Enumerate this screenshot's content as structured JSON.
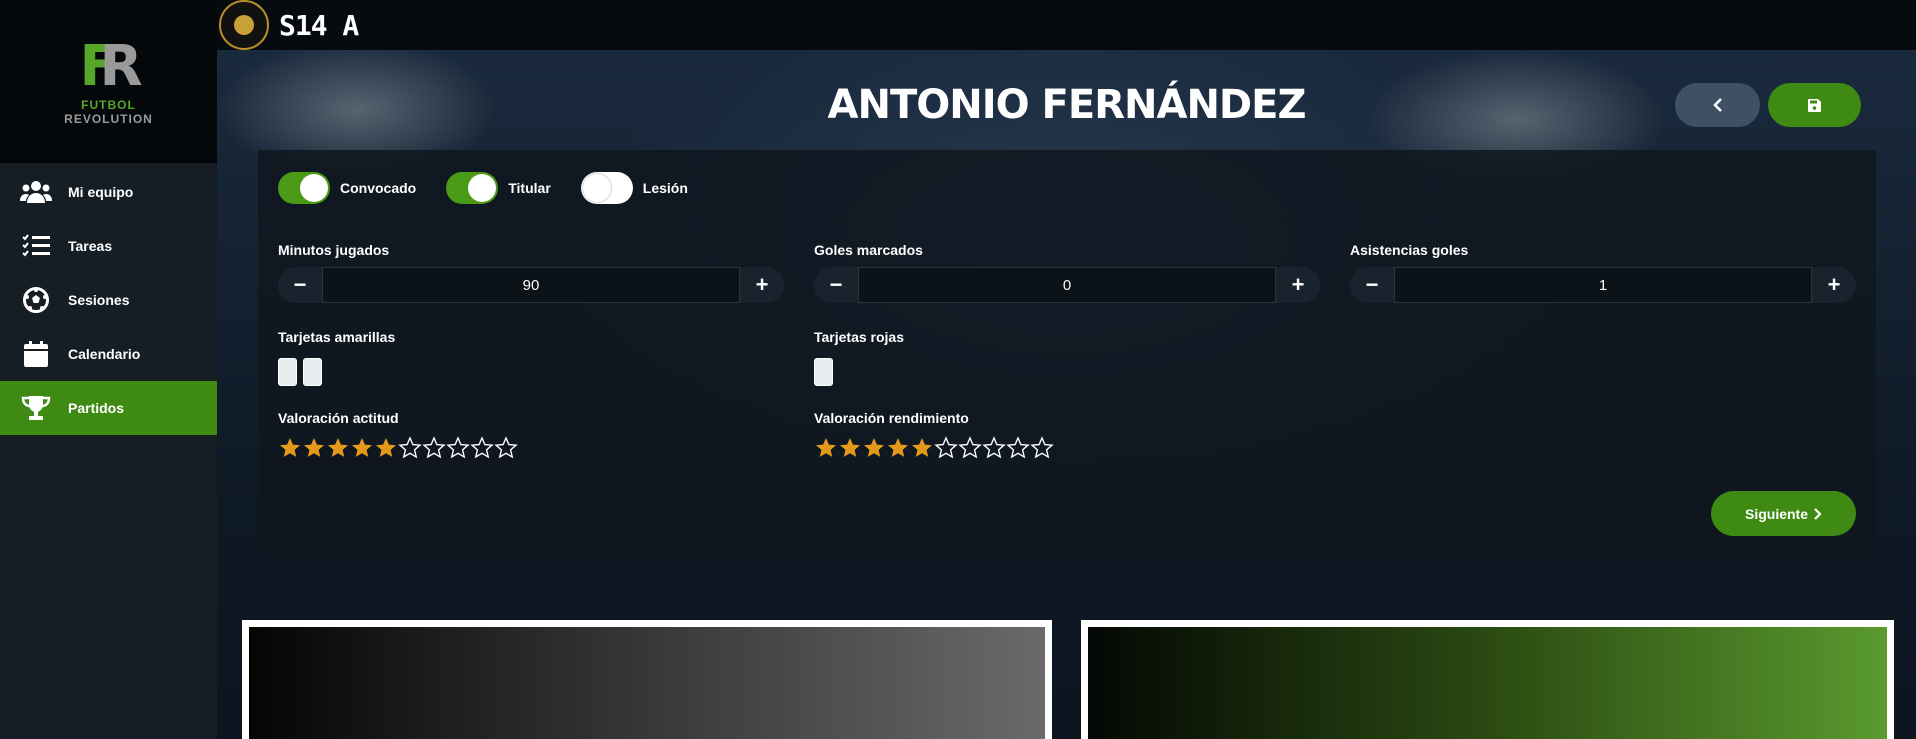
{
  "sidebar": {
    "logo": {
      "line1": "FUTBOL",
      "line2": "REVOLUTION",
      "mark": [
        "F",
        "R"
      ]
    },
    "items": [
      {
        "label": "Mi equipo",
        "icon": "users-icon",
        "active": false
      },
      {
        "label": "Tareas",
        "icon": "task-list-icon",
        "active": false
      },
      {
        "label": "Sesiones",
        "icon": "soccer-ball-icon",
        "active": false
      },
      {
        "label": "Calendario",
        "icon": "calendar-icon",
        "active": false
      },
      {
        "label": "Partidos",
        "icon": "trophy-icon",
        "active": true
      }
    ]
  },
  "topbar": {
    "team": "S14 A",
    "badge_icon": "club-badge-icon"
  },
  "player": {
    "name": "ANTONIO FERNÁNDEZ"
  },
  "toggles": [
    {
      "label": "Convocado",
      "on": true
    },
    {
      "label": "Titular",
      "on": true
    },
    {
      "label": "Lesión",
      "on": false
    }
  ],
  "stats": {
    "minutes": {
      "label": "Minutos jugados",
      "value": "90"
    },
    "goals": {
      "label": "Goles marcados",
      "value": "0"
    },
    "assists": {
      "label": "Asistencias goles",
      "value": "1"
    }
  },
  "cards": {
    "yellow": {
      "label": "Tarjetas amarillas",
      "count": 2
    },
    "red": {
      "label": "Tarjetas rojas",
      "count": 1
    }
  },
  "ratings": {
    "attitude": {
      "label": "Valoración actitud",
      "value": 5,
      "max": 10
    },
    "performance": {
      "label": "Valoración rendimiento",
      "value": 5,
      "max": 10
    }
  },
  "buttons": {
    "next": "Siguiente",
    "back_icon": "chevron-left-icon",
    "save_icon": "save-icon"
  },
  "colors": {
    "accent": "#3e8a13",
    "star": "#e39a1b"
  }
}
